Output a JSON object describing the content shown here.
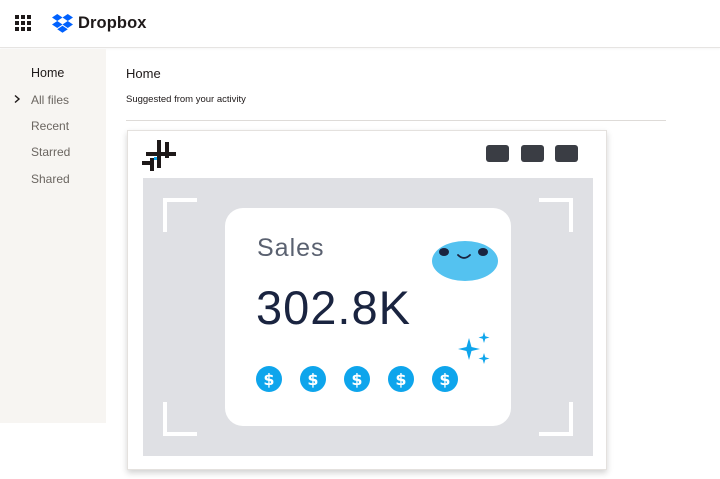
{
  "app": {
    "name": "Dropbox",
    "brand_color": "#0061fe",
    "apps_icon": "apps-grid-icon"
  },
  "sidebar": {
    "items": [
      {
        "label": "Home",
        "active": true
      },
      {
        "label": "All files",
        "active": false,
        "icon": "chevron-right-icon"
      },
      {
        "label": "Recent",
        "active": false
      },
      {
        "label": "Starred",
        "active": false
      },
      {
        "label": "Shared",
        "active": false
      }
    ]
  },
  "main": {
    "title": "Home",
    "subtitle": "Suggested from your activity"
  },
  "preview": {
    "sales_label": "Sales",
    "sales_value": "302.8K",
    "coin_symbol": "$",
    "coin_count": 5,
    "accent_color": "#0ea5ec",
    "blob_color": "#54c2f0",
    "window_button_color": "#3a3d44"
  }
}
